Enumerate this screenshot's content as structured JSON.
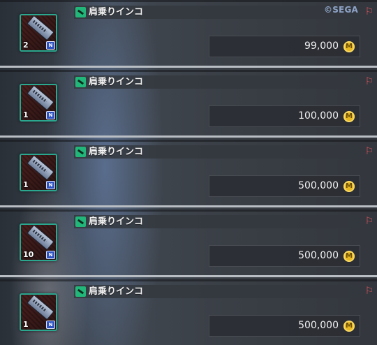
{
  "copyright": "©SEGA",
  "icons": {
    "category": "ticket-tag-icon",
    "trade": "trade-restricted-icon",
    "currency": "meseta-icon"
  },
  "colors": {
    "thumb_border": "#2aa78e",
    "category_tag": "#22b67a",
    "currency": "#e8b923",
    "trade_icon": "#e2575e"
  },
  "listings": [
    {
      "name": "肩乗りインコ",
      "quantity": "2",
      "price": "99,000"
    },
    {
      "name": "肩乗りインコ",
      "quantity": "1",
      "price": "100,000"
    },
    {
      "name": "肩乗りインコ",
      "quantity": "1",
      "price": "500,000"
    },
    {
      "name": "肩乗りインコ",
      "quantity": "10",
      "price": "500,000"
    },
    {
      "name": "肩乗りインコ",
      "quantity": "1",
      "price": "500,000"
    }
  ]
}
